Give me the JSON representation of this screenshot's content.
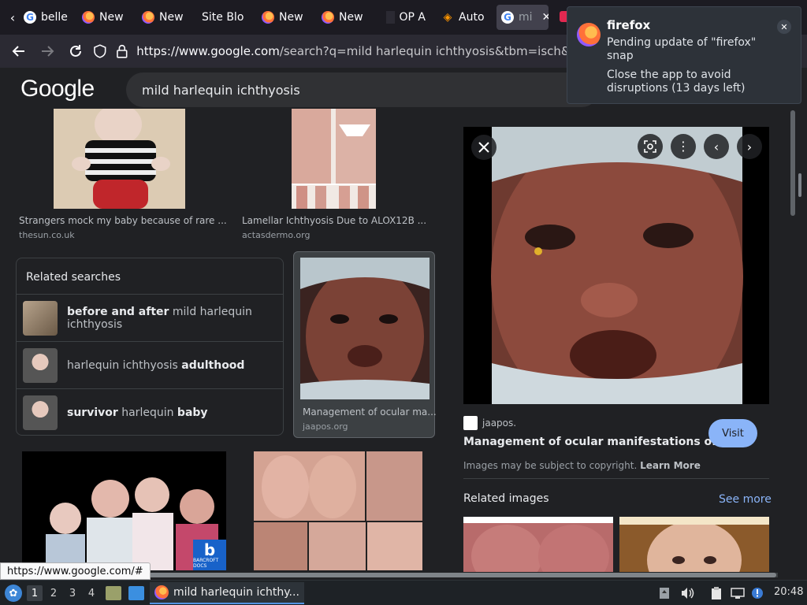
{
  "tabs": [
    {
      "label": "belle",
      "icon": "google-icon"
    },
    {
      "label": "New",
      "icon": "firefox-icon"
    },
    {
      "label": "New",
      "icon": "firefox-icon"
    },
    {
      "label": "Site Blo",
      "icon": "none"
    },
    {
      "label": "New",
      "icon": "firefox-icon"
    },
    {
      "label": "New",
      "icon": "firefox-icon"
    },
    {
      "label": "OP A",
      "icon": "none"
    },
    {
      "label": "Auto",
      "icon": "autohotkey-icon"
    },
    {
      "label": "mi",
      "icon": "google-icon",
      "active": true
    }
  ],
  "navbar": {
    "url_host": "https://www.google.com",
    "url_path": "/search?q=mild harlequin ichthyosis&tbm=isch&hl="
  },
  "google": {
    "logo": "Google",
    "query": "mild harlequin ichthyosis"
  },
  "results": {
    "top_left": {
      "caption": "Strangers mock my baby because of rare ...",
      "source": "thesun.co.uk"
    },
    "top_right": {
      "caption": "Lamellar Ichthyosis Due to ALOX12B ...",
      "source": "actasdermo.org"
    },
    "selected": {
      "caption": "Management of ocular ma...",
      "source": "jaapos.org"
    }
  },
  "related_searches": {
    "title": "Related searches",
    "items": [
      {
        "bold_pre": "before and after",
        "normal": " mild harlequin ichthyosis",
        "bold_post": ""
      },
      {
        "bold_pre": "",
        "normal": "harlequin ichthyosis ",
        "bold_post": "adulthood"
      },
      {
        "bold_pre": "survivor",
        "normal": " harlequin ",
        "bold_post": "baby"
      }
    ]
  },
  "barcroft_label": "BARCROFT DOCS",
  "preview": {
    "site": "jaapos.",
    "title": "Management of ocular manifestations of a...",
    "visit": "Visit",
    "copyright": "Images may be subject to copyright.",
    "learn_more": "Learn More",
    "related_images": "Related images",
    "see_more": "See more"
  },
  "notification": {
    "app": "firefox",
    "line1": "Pending update of \"firefox\" snap",
    "line2": "Close the app to avoid disruptions (13 days left)"
  },
  "status_url": "https://www.google.com/#",
  "taskbar": {
    "workspaces": [
      "1",
      "2",
      "3",
      "4"
    ],
    "current_workspace": "1",
    "window_title": "mild harlequin ichthy...",
    "clock": "20:48"
  },
  "colors": {
    "accent": "#8ab4f8",
    "background": "#202124",
    "link": "#8ab4f8"
  }
}
